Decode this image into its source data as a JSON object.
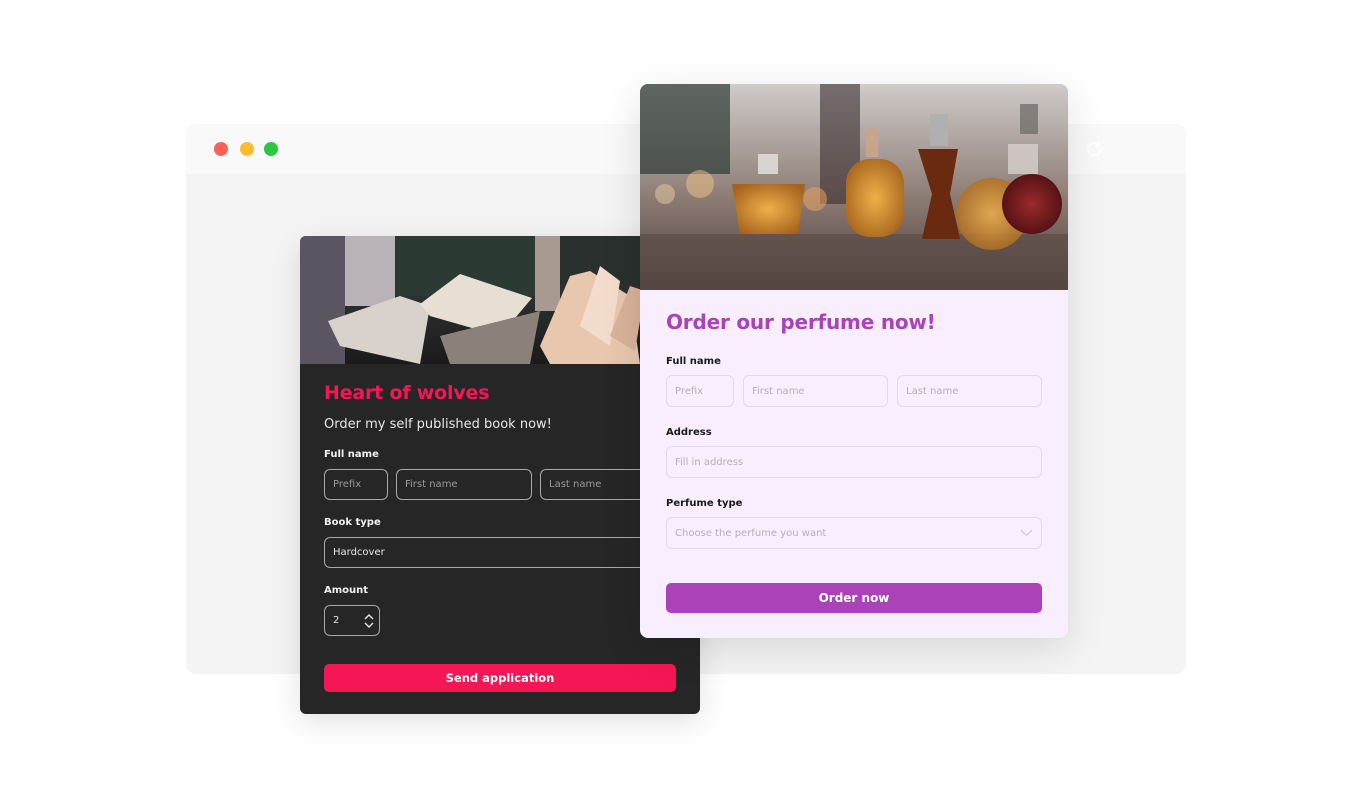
{
  "browser": {
    "window_controls": [
      "close",
      "minimize",
      "maximize"
    ],
    "reload_icon": "reload-icon"
  },
  "book_form": {
    "title": "Heart of wolves",
    "subtitle": "Order my self published book now!",
    "accent_color": "#f51656",
    "full_name": {
      "label": "Full name",
      "prefix_placeholder": "Prefix",
      "first_placeholder": "First name",
      "last_placeholder": "Last name"
    },
    "book_type": {
      "label": "Book type",
      "value": "Hardcover"
    },
    "amount": {
      "label": "Amount",
      "value": "2"
    },
    "submit_label": "Send application"
  },
  "perfume_form": {
    "title": "Order our perfume now!",
    "accent_color": "#ac42b8",
    "full_name": {
      "label": "Full name",
      "prefix_placeholder": "Prefix",
      "first_placeholder": "First name",
      "last_placeholder": "Last name"
    },
    "address": {
      "label": "Address",
      "placeholder": "Fill in address"
    },
    "perfume_type": {
      "label": "Perfume type",
      "placeholder": "Choose the perfume you want"
    },
    "submit_label": "Order now"
  }
}
